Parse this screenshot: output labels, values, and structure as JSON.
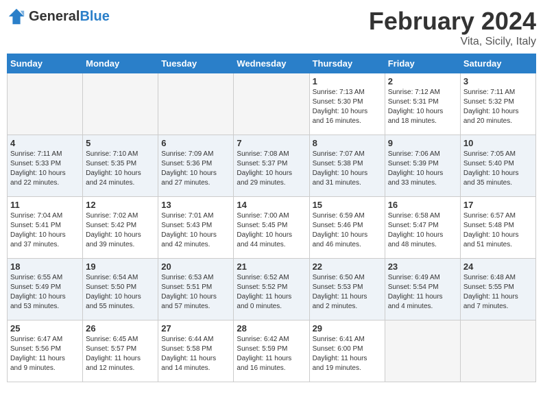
{
  "header": {
    "logo_general": "General",
    "logo_blue": "Blue",
    "title": "February 2024",
    "subtitle": "Vita, Sicily, Italy"
  },
  "weekdays": [
    "Sunday",
    "Monday",
    "Tuesday",
    "Wednesday",
    "Thursday",
    "Friday",
    "Saturday"
  ],
  "weeks": [
    [
      {
        "day": "",
        "info": ""
      },
      {
        "day": "",
        "info": ""
      },
      {
        "day": "",
        "info": ""
      },
      {
        "day": "",
        "info": ""
      },
      {
        "day": "1",
        "info": "Sunrise: 7:13 AM\nSunset: 5:30 PM\nDaylight: 10 hours\nand 16 minutes."
      },
      {
        "day": "2",
        "info": "Sunrise: 7:12 AM\nSunset: 5:31 PM\nDaylight: 10 hours\nand 18 minutes."
      },
      {
        "day": "3",
        "info": "Sunrise: 7:11 AM\nSunset: 5:32 PM\nDaylight: 10 hours\nand 20 minutes."
      }
    ],
    [
      {
        "day": "4",
        "info": "Sunrise: 7:11 AM\nSunset: 5:33 PM\nDaylight: 10 hours\nand 22 minutes."
      },
      {
        "day": "5",
        "info": "Sunrise: 7:10 AM\nSunset: 5:35 PM\nDaylight: 10 hours\nand 24 minutes."
      },
      {
        "day": "6",
        "info": "Sunrise: 7:09 AM\nSunset: 5:36 PM\nDaylight: 10 hours\nand 27 minutes."
      },
      {
        "day": "7",
        "info": "Sunrise: 7:08 AM\nSunset: 5:37 PM\nDaylight: 10 hours\nand 29 minutes."
      },
      {
        "day": "8",
        "info": "Sunrise: 7:07 AM\nSunset: 5:38 PM\nDaylight: 10 hours\nand 31 minutes."
      },
      {
        "day": "9",
        "info": "Sunrise: 7:06 AM\nSunset: 5:39 PM\nDaylight: 10 hours\nand 33 minutes."
      },
      {
        "day": "10",
        "info": "Sunrise: 7:05 AM\nSunset: 5:40 PM\nDaylight: 10 hours\nand 35 minutes."
      }
    ],
    [
      {
        "day": "11",
        "info": "Sunrise: 7:04 AM\nSunset: 5:41 PM\nDaylight: 10 hours\nand 37 minutes."
      },
      {
        "day": "12",
        "info": "Sunrise: 7:02 AM\nSunset: 5:42 PM\nDaylight: 10 hours\nand 39 minutes."
      },
      {
        "day": "13",
        "info": "Sunrise: 7:01 AM\nSunset: 5:43 PM\nDaylight: 10 hours\nand 42 minutes."
      },
      {
        "day": "14",
        "info": "Sunrise: 7:00 AM\nSunset: 5:45 PM\nDaylight: 10 hours\nand 44 minutes."
      },
      {
        "day": "15",
        "info": "Sunrise: 6:59 AM\nSunset: 5:46 PM\nDaylight: 10 hours\nand 46 minutes."
      },
      {
        "day": "16",
        "info": "Sunrise: 6:58 AM\nSunset: 5:47 PM\nDaylight: 10 hours\nand 48 minutes."
      },
      {
        "day": "17",
        "info": "Sunrise: 6:57 AM\nSunset: 5:48 PM\nDaylight: 10 hours\nand 51 minutes."
      }
    ],
    [
      {
        "day": "18",
        "info": "Sunrise: 6:55 AM\nSunset: 5:49 PM\nDaylight: 10 hours\nand 53 minutes."
      },
      {
        "day": "19",
        "info": "Sunrise: 6:54 AM\nSunset: 5:50 PM\nDaylight: 10 hours\nand 55 minutes."
      },
      {
        "day": "20",
        "info": "Sunrise: 6:53 AM\nSunset: 5:51 PM\nDaylight: 10 hours\nand 57 minutes."
      },
      {
        "day": "21",
        "info": "Sunrise: 6:52 AM\nSunset: 5:52 PM\nDaylight: 11 hours\nand 0 minutes."
      },
      {
        "day": "22",
        "info": "Sunrise: 6:50 AM\nSunset: 5:53 PM\nDaylight: 11 hours\nand 2 minutes."
      },
      {
        "day": "23",
        "info": "Sunrise: 6:49 AM\nSunset: 5:54 PM\nDaylight: 11 hours\nand 4 minutes."
      },
      {
        "day": "24",
        "info": "Sunrise: 6:48 AM\nSunset: 5:55 PM\nDaylight: 11 hours\nand 7 minutes."
      }
    ],
    [
      {
        "day": "25",
        "info": "Sunrise: 6:47 AM\nSunset: 5:56 PM\nDaylight: 11 hours\nand 9 minutes."
      },
      {
        "day": "26",
        "info": "Sunrise: 6:45 AM\nSunset: 5:57 PM\nDaylight: 11 hours\nand 12 minutes."
      },
      {
        "day": "27",
        "info": "Sunrise: 6:44 AM\nSunset: 5:58 PM\nDaylight: 11 hours\nand 14 minutes."
      },
      {
        "day": "28",
        "info": "Sunrise: 6:42 AM\nSunset: 5:59 PM\nDaylight: 11 hours\nand 16 minutes."
      },
      {
        "day": "29",
        "info": "Sunrise: 6:41 AM\nSunset: 6:00 PM\nDaylight: 11 hours\nand 19 minutes."
      },
      {
        "day": "",
        "info": ""
      },
      {
        "day": "",
        "info": ""
      }
    ]
  ]
}
